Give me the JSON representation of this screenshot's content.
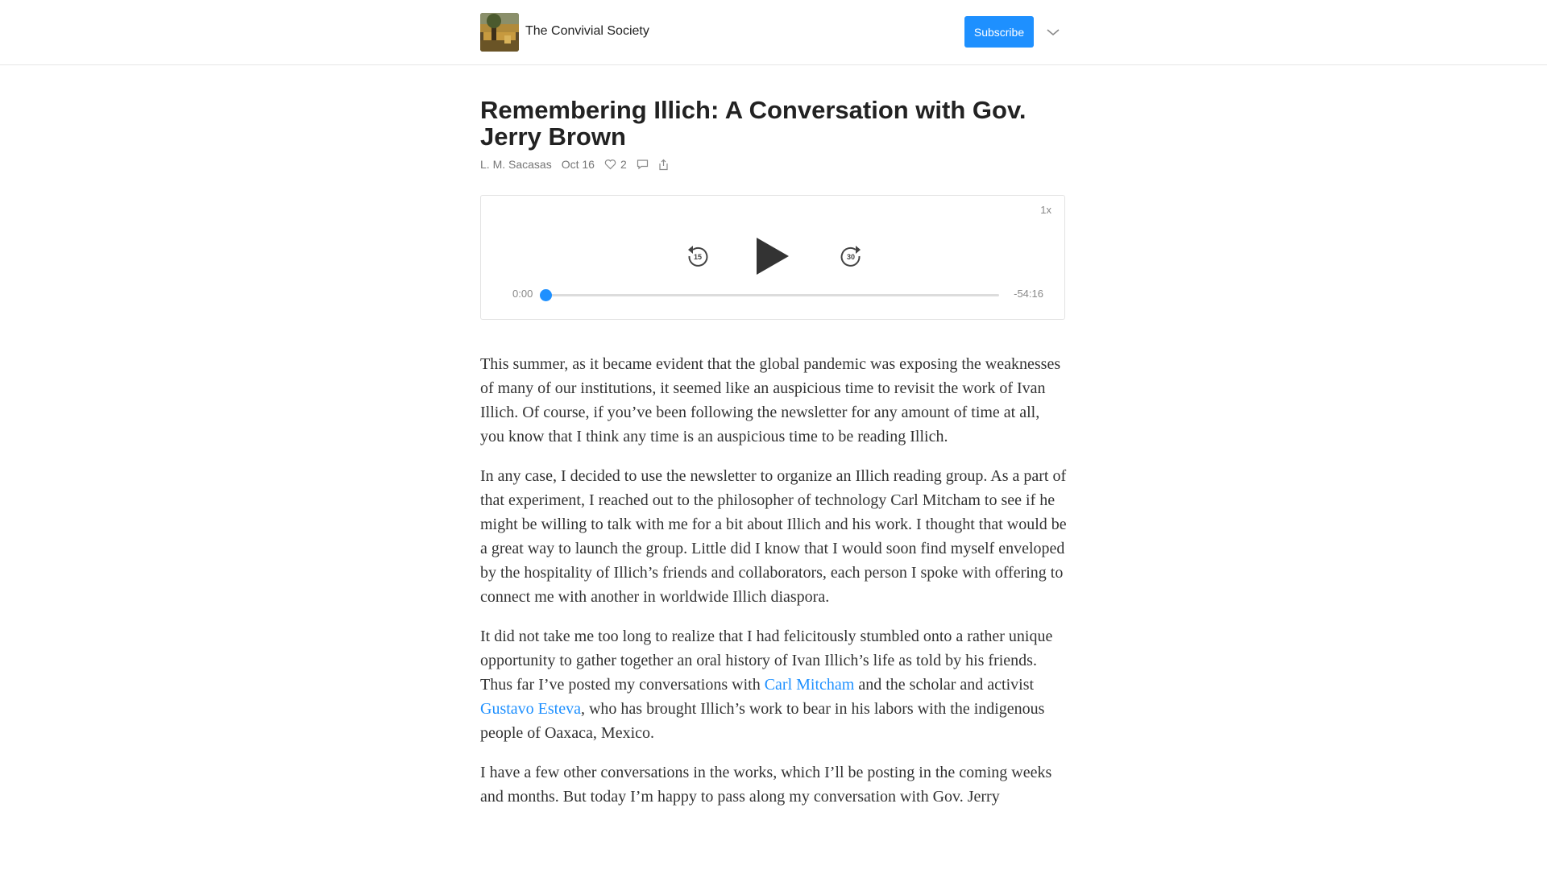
{
  "header": {
    "publication_name": "The Convivial Society",
    "subscribe_label": "Subscribe",
    "logo_icon": "painting-thumbnail"
  },
  "article": {
    "title": "Remembering Illich: A Conversation with Gov. Jerry Brown",
    "author": "L. M. Sacasas",
    "date": "Oct 16",
    "likes": "2"
  },
  "player": {
    "speed": "1x",
    "current_time": "0:00",
    "remaining_time": "-54:16",
    "progress": 0,
    "skip_back_seconds": "15",
    "skip_forward_seconds": "30"
  },
  "body": {
    "p1": "This summer, as it became evident that the global pandemic was exposing the weaknesses of many of our institutions, it seemed like an auspicious time to revisit the work of Ivan Illich. Of course, if you’ve been following the newsletter for any amount of time at all, you know that I think any time is an auspicious time to be reading Illich.",
    "p2": "In any case, I decided to use the newsletter to organize an Illich reading group. As a part of that experiment, I reached out to the philosopher of technology Carl Mitcham to see if he might be willing to talk with me for a bit about Illich and his work. I thought that would be a great way to launch the group. Little did I know that I would soon find myself enveloped by the hospitality of Illich’s friends and collaborators, each person I spoke with offering to connect me with another in worldwide Illich diaspora.",
    "p3_a": "It did not take me too long to realize that I had felicitously stumbled onto a rather unique opportunity to gather together an oral history of Ivan Illich’s life as told by his friends. Thus far I’ve posted my conversations with ",
    "p3_link1": "Carl Mitcham",
    "p3_b": " and the scholar and activist ",
    "p3_link2": "Gustavo Esteva",
    "p3_c": ", who has brought Illich’s work to bear in his labors with the indigenous people of Oaxaca, Mexico.",
    "p4": "I have a few other conversations in the works, which I’ll be posting in the coming weeks and months. But today I’m happy to pass along my conversation with Gov. Jerry"
  },
  "colors": {
    "accent": "#1e90ff",
    "text": "#333333",
    "muted": "#767676"
  }
}
